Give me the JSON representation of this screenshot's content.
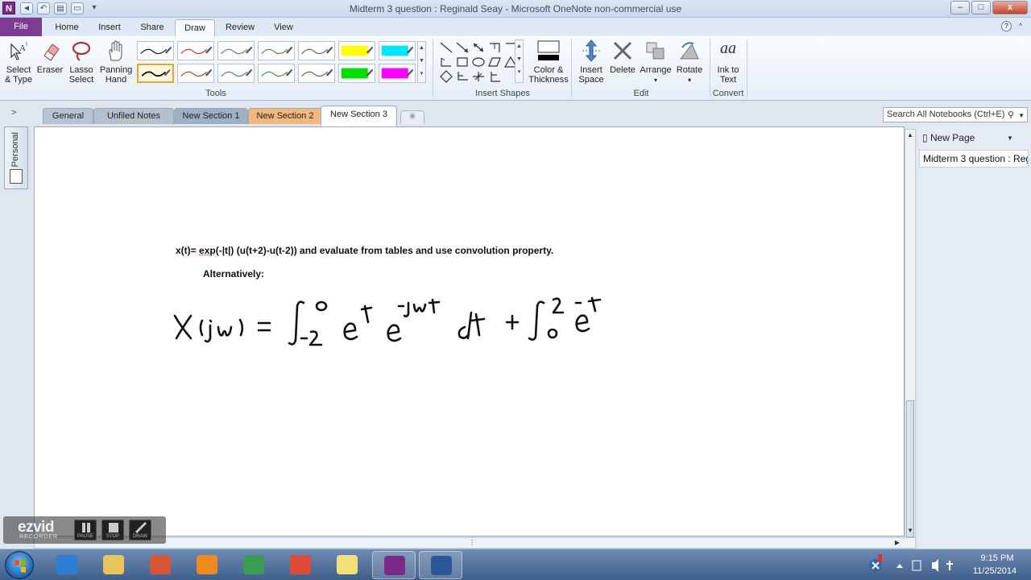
{
  "window": {
    "title": "Midterm 3 question : Reginald Seay - Microsoft OneNote non-commercial use",
    "app_icon": "N",
    "minimize": "–",
    "maximize": "□",
    "close": "x"
  },
  "quick_access": {
    "back": "◄",
    "undo": "↶",
    "dock": "▤",
    "fullpage": "▭",
    "customize": "▾"
  },
  "ribbon_tabs": [
    "File",
    "Home",
    "Insert",
    "Share",
    "Draw",
    "Review",
    "View"
  ],
  "ribbon_active_tab": "Draw",
  "ribbon": {
    "tools": {
      "label": "Tools",
      "select_text_l1": "Select",
      "select_text_l2": "& Type",
      "eraser": "Eraser",
      "lasso_l1": "Lasso",
      "lasso_l2": "Select",
      "panning_l1": "Panning",
      "panning_l2": "Hand"
    },
    "insert_shapes": {
      "label": "Insert Shapes"
    },
    "color_thickness_l1": "Color &",
    "color_thickness_l2": "Thickness",
    "edit": {
      "label": "Edit",
      "insert_space_l1": "Insert",
      "insert_space_l2": "Space",
      "delete": "Delete",
      "arrange": "Arrange",
      "rotate": "Rotate"
    },
    "convert": {
      "label": "Convert",
      "ink_to_text_l1": "Ink to",
      "ink_to_text_l2": "Text",
      "glyph": "aa"
    }
  },
  "pens": [
    {
      "color": "#000000",
      "row": 0,
      "col": 0
    },
    {
      "color": "#c0302a",
      "row": 0,
      "col": 1
    },
    {
      "color": "#4a6fb0",
      "row": 0,
      "col": 2
    },
    {
      "color": "#3a8a3a",
      "row": 0,
      "col": 3
    },
    {
      "color": "#555555",
      "row": 0,
      "col": 4
    },
    {
      "color": "#ffff00",
      "row": 0,
      "col": 5
    },
    {
      "color": "#00e5ff",
      "row": 0,
      "col": 6
    },
    {
      "color": "#000000",
      "row": 1,
      "col": 0,
      "selected": true
    },
    {
      "color": "#c0302a",
      "row": 1,
      "col": 1
    },
    {
      "color": "#4a6fb0",
      "row": 1,
      "col": 2
    },
    {
      "color": "#3a8a3a",
      "row": 1,
      "col": 3
    },
    {
      "color": "#555555",
      "row": 1,
      "col": 4
    },
    {
      "color": "#00e000",
      "row": 1,
      "col": 5
    },
    {
      "color": "#ff00ff",
      "row": 1,
      "col": 6
    }
  ],
  "sections": [
    {
      "label": "General",
      "color": "#b7c4d4"
    },
    {
      "label": "Unfiled Notes",
      "color": "#b4c0cc"
    },
    {
      "label": "New Section 1",
      "color": "#9eb0c4"
    },
    {
      "label": "New Section 2",
      "color": "#f4b77e"
    },
    {
      "label": "New Section 3",
      "color": "#ffffff"
    }
  ],
  "add_section": "✳",
  "nav_expand": ">",
  "search": {
    "placeholder": "Search All Notebooks (Ctrl+E)"
  },
  "notebook": {
    "name": "Personal"
  },
  "page_content": {
    "line1_pre": "x(t)= ",
    "line1_exp": "exp",
    "line1_post": "(-|t|) (u(t+2)-u(t-2)) and evaluate from tables and use convolution property.",
    "line2": "Alternatively:"
  },
  "page_pane": {
    "new_page": "New Page",
    "pages": [
      "Midterm 3 question : Reg"
    ]
  },
  "ezvid": {
    "logo": "ezvid",
    "sub": "RECORDER",
    "buttons": [
      "PAUSE",
      "STOP",
      "DRAW"
    ]
  },
  "taskbar": {
    "apps": [
      {
        "name": "internet-explorer",
        "color": "#2d7fd6",
        "open": false
      },
      {
        "name": "file-explorer",
        "color": "#e8c45a",
        "open": false
      },
      {
        "name": "media-app",
        "color": "#d7563a",
        "open": false
      },
      {
        "name": "media-player",
        "color": "#f08a1c",
        "open": false
      },
      {
        "name": "hp-app",
        "color": "#3a9b52",
        "open": false
      },
      {
        "name": "chrome",
        "color": "#dd4b39",
        "open": false
      },
      {
        "name": "sticky-notes",
        "color": "#f4e07a",
        "open": false
      },
      {
        "name": "onenote",
        "color": "#7b2a8a",
        "open": true
      },
      {
        "name": "word",
        "color": "#2b5797",
        "open": true
      }
    ],
    "clock_time": "9:15 PM",
    "clock_date": "11/25/2014"
  }
}
